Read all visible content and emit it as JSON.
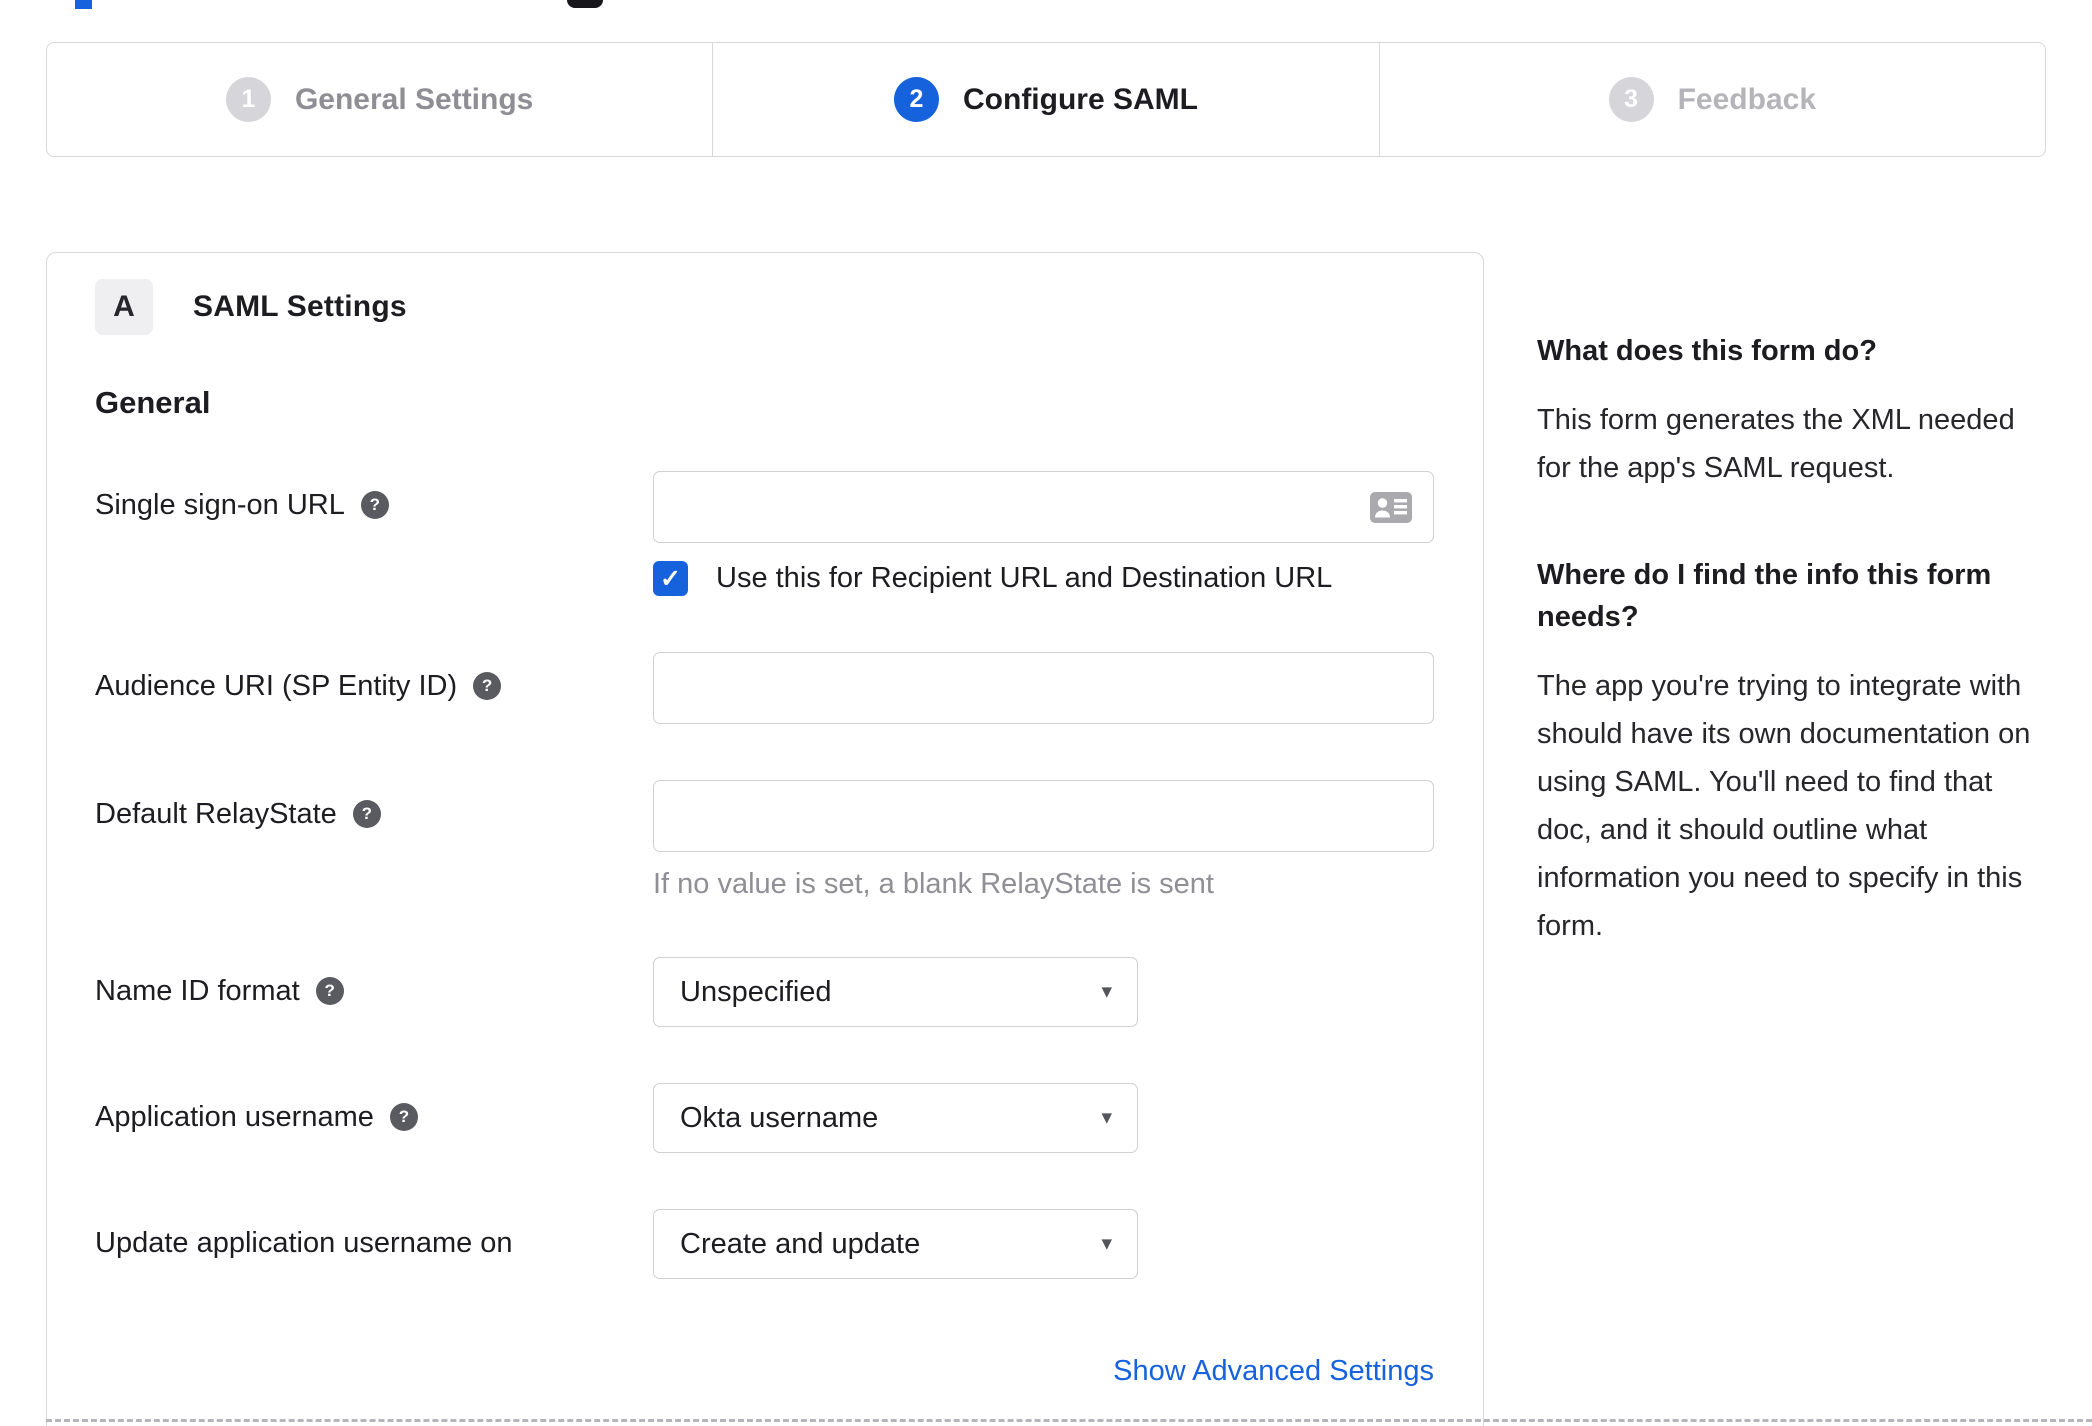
{
  "colors": {
    "accent_blue": "#1662dd",
    "step_inactive_circle": "#d6d6da",
    "border_gray": "#d8d8dc",
    "text_dark": "#1d1d21",
    "muted_gray": "#8f8f95"
  },
  "icons": {
    "help": "?",
    "checkmark": "✓",
    "caret_down": "▾"
  },
  "stepper": {
    "steps": [
      {
        "number": "1",
        "label": "General Settings",
        "state": "done"
      },
      {
        "number": "2",
        "label": "Configure SAML",
        "state": "active"
      },
      {
        "number": "3",
        "label": "Feedback",
        "state": "disabled"
      }
    ]
  },
  "form": {
    "badge": "A",
    "title": "SAML Settings",
    "section": "General",
    "sso": {
      "label": "Single sign-on URL",
      "value": "",
      "checkbox_label": "Use this for Recipient URL and Destination URL",
      "checked": true
    },
    "audience": {
      "label": "Audience URI (SP Entity ID)",
      "value": ""
    },
    "relay": {
      "label": "Default RelayState",
      "value": "",
      "hint": "If no value is set, a blank RelayState is sent"
    },
    "name_id": {
      "label": "Name ID format",
      "value": "Unspecified"
    },
    "app_username": {
      "label": "Application username",
      "value": "Okta username"
    },
    "update_username": {
      "label": "Update application username on",
      "value": "Create and update"
    },
    "advanced_link": "Show Advanced Settings"
  },
  "sidebar": {
    "sections": [
      {
        "heading": "What does this form do?",
        "body": "This form generates the XML needed for the app's SAML request."
      },
      {
        "heading": "Where do I find the info this form needs?",
        "body": "The app you're trying to integrate with should have its own documentation on using SAML. You'll need to find that doc, and it should outline what information you need to specify in this form."
      }
    ]
  }
}
